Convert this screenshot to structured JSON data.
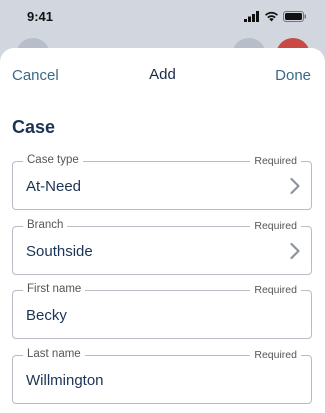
{
  "status": {
    "time": "9:41"
  },
  "nav": {
    "cancel": "Cancel",
    "title": "Add",
    "done": "Done"
  },
  "section": {
    "title": "Case"
  },
  "fields": [
    {
      "label": "Case type",
      "required": "Required",
      "value": "At-Need",
      "has_chevron": true
    },
    {
      "label": "Branch",
      "required": "Required",
      "value": "Southside",
      "has_chevron": true
    },
    {
      "label": "First name",
      "required": "Required",
      "value": "Becky",
      "has_chevron": false
    },
    {
      "label": "Last name",
      "required": "Required",
      "value": "Willmington",
      "has_chevron": false
    }
  ],
  "colors": {
    "accent": "#3a6a88",
    "title": "#1b3455",
    "background": "#d2d7df",
    "red_avatar": "#c94a45"
  }
}
